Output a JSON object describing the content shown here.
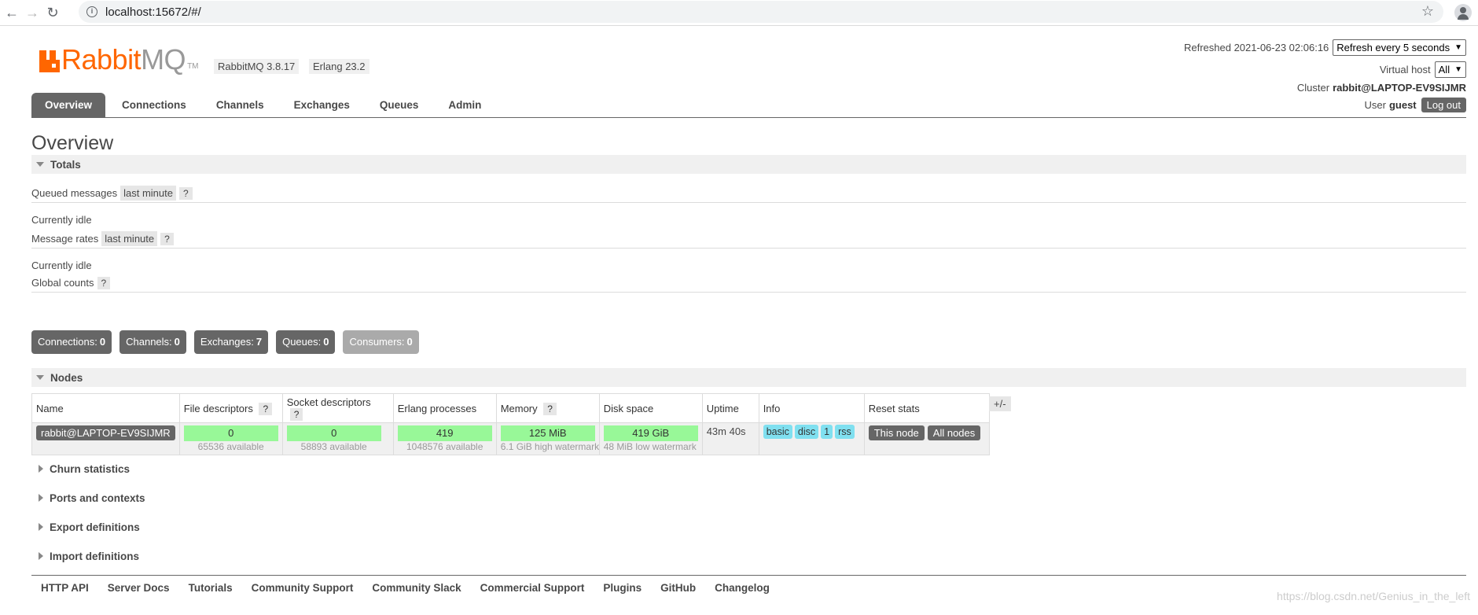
{
  "browser": {
    "url": "localhost:15672/#/"
  },
  "header": {
    "logo_rabbit": "Rabbit",
    "logo_mq": "MQ",
    "logo_tm": "TM",
    "rabbitmq_version": "RabbitMQ 3.8.17",
    "erlang_version": "Erlang 23.2",
    "refreshed_label": "Refreshed 2021-06-23 02:06:16",
    "refresh_select": "Refresh every 5 seconds",
    "vhost_label": "Virtual host",
    "vhost_select": "All",
    "cluster_label": "Cluster",
    "cluster_name": "rabbit@LAPTOP-EV9SIJMR",
    "user_label": "User",
    "user_name": "guest",
    "logout": "Log out"
  },
  "tabs": [
    "Overview",
    "Connections",
    "Channels",
    "Exchanges",
    "Queues",
    "Admin"
  ],
  "page_title": "Overview",
  "totals": {
    "heading": "Totals",
    "queued_messages": "Queued messages",
    "queued_range": "last minute",
    "help": "?",
    "idle_1": "Currently idle",
    "message_rates": "Message rates",
    "rates_range": "last minute",
    "idle_2": "Currently idle",
    "global_counts": "Global counts"
  },
  "counts": [
    {
      "label": "Connections:",
      "value": "0"
    },
    {
      "label": "Channels:",
      "value": "0"
    },
    {
      "label": "Exchanges:",
      "value": "7"
    },
    {
      "label": "Queues:",
      "value": "0"
    },
    {
      "label": "Consumers:",
      "value": "0"
    }
  ],
  "nodes": {
    "heading": "Nodes",
    "columns": [
      "Name",
      "File descriptors",
      "Socket descriptors",
      "Erlang processes",
      "Memory",
      "Disk space",
      "Uptime",
      "Info",
      "Reset stats"
    ],
    "row": {
      "name": "rabbit@LAPTOP-EV9SIJMR",
      "file_desc": "0",
      "file_desc_sub": "65536 available",
      "socket_desc": "0",
      "socket_desc_sub": "58893 available",
      "erlang_proc": "419",
      "erlang_proc_sub": "1048576 available",
      "memory": "125 MiB",
      "memory_sub": "6.1 GiB high watermark",
      "disk": "419 GiB",
      "disk_sub": "48 MiB low watermark",
      "uptime": "43m 40s",
      "info": [
        "basic",
        "disc",
        "1",
        "rss"
      ],
      "reset_this": "This node",
      "reset_all": "All nodes"
    },
    "plus_minus": "+/-"
  },
  "collapsed_sections": [
    "Churn statistics",
    "Ports and contexts",
    "Export definitions",
    "Import definitions"
  ],
  "footer_links": [
    "HTTP API",
    "Server Docs",
    "Tutorials",
    "Community Support",
    "Community Slack",
    "Commercial Support",
    "Plugins",
    "GitHub",
    "Changelog"
  ],
  "watermark": "https://blog.csdn.net/Genius_in_the_left"
}
